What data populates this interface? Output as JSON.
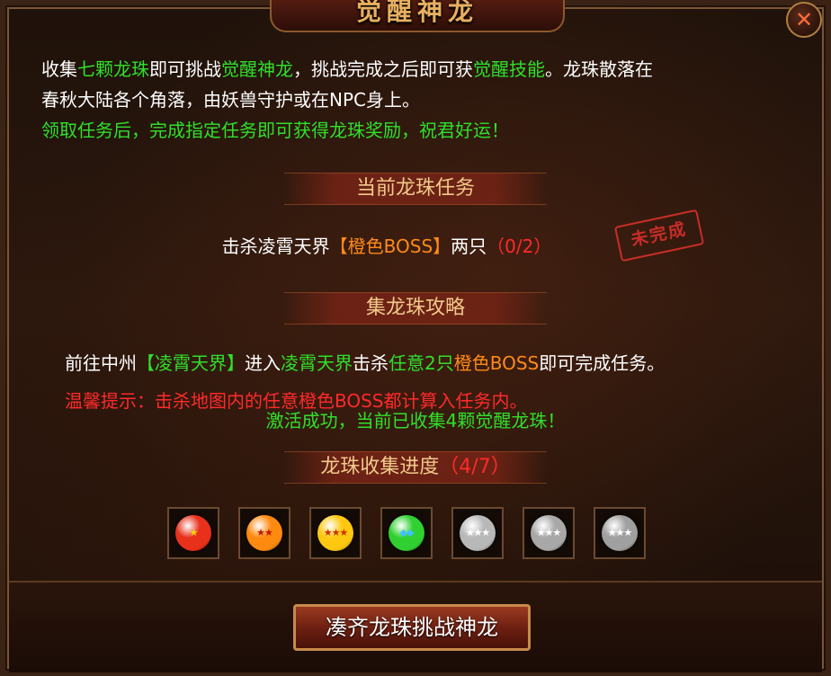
{
  "title": "觉醒神龙",
  "close_label": "✕",
  "intro": {
    "p1": "收集",
    "p1_green": "七颗龙珠",
    "p2": "即可挑战",
    "p2_green": "觉醒神龙",
    "p3": "，挑战完成之后即可获",
    "p3_green": "觉醒技能",
    "p4": "。龙珠散落在",
    "line2": "春秋大陆各个角落，由妖兽守护或在NPC身上。",
    "line3": "领取任务后，完成指定任务即可获得龙珠奖励，祝君好运！"
  },
  "current_task": {
    "header": "当前龙珠任务",
    "prefix": "击杀凌霄天界",
    "target": "【橙色BOSS】",
    "mid": "两只",
    "progress": "（0/2）",
    "stamp": "未完成"
  },
  "guide": {
    "header": "集龙珠攻略",
    "t1": "前往中州",
    "g1": "【凌霄天界】",
    "t2": "进入",
    "g2": "凌霄天界",
    "t3": "击杀",
    "g3": "任意2只",
    "o1": "橙色BOSS",
    "t4": "即可完成任务。",
    "tip": "温馨提示：击杀地图内的任意橙色BOSS都计算入任务内。",
    "success": "激活成功，当前已收集4颗觉醒龙珠！"
  },
  "progress": {
    "label": "龙珠收集进度",
    "count": "（4/7）",
    "collected": 4,
    "total": 7
  },
  "orbs": [
    {
      "name": "orb-red",
      "color": "#e8301a",
      "star": "#ffd000",
      "stars": "★"
    },
    {
      "name": "orb-orange",
      "color": "#ff8a10",
      "star": "#c01800",
      "stars": "★★"
    },
    {
      "name": "orb-yellow",
      "color": "#ffc810",
      "star": "#d03000",
      "stars": "★★★"
    },
    {
      "name": "orb-green",
      "color": "#30d030",
      "star": "#40c0ff",
      "stars": "◆◆"
    },
    {
      "name": "orb-gray-1",
      "color": "#b8b8b8",
      "star": "#ffffff",
      "stars": "★★★"
    },
    {
      "name": "orb-gray-2",
      "color": "#a8a8a8",
      "star": "#ffffff",
      "stars": "★★★"
    },
    {
      "name": "orb-gray-3",
      "color": "#a0a0a0",
      "star": "#ffffff",
      "stars": "★★★"
    }
  ],
  "button": {
    "label": "凑齐龙珠挑战神龙"
  }
}
